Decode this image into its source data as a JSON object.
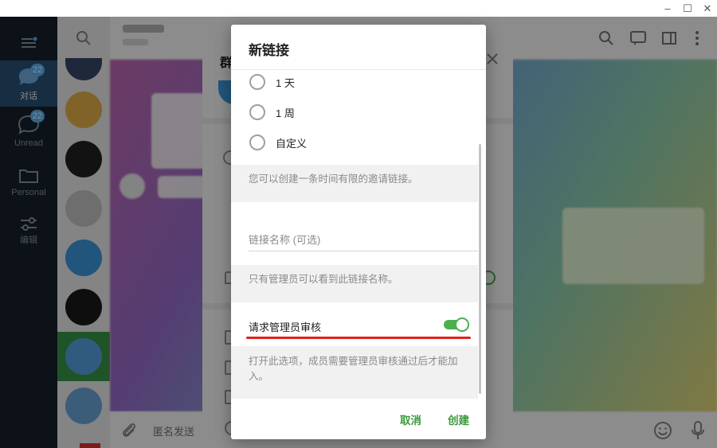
{
  "window": {
    "minimize_glyph": "–",
    "maximize_glyph": "☐",
    "close_glyph": "✕"
  },
  "rail": {
    "items": [
      {
        "label": "对话",
        "badge": "22",
        "icon": "chat-bubble-icon"
      },
      {
        "label": "Unread",
        "badge": "22",
        "icon": "chat-outline-icon"
      },
      {
        "label": "Personal",
        "icon": "folder-icon"
      },
      {
        "label": "编辑",
        "icon": "sliders-icon"
      }
    ]
  },
  "background_dialog": {
    "title_fragment": "群"
  },
  "conversation": {
    "input_placeholder": "匿名发送"
  },
  "modal": {
    "title": "新链接",
    "options": [
      {
        "label": "1 天",
        "selected": false
      },
      {
        "label": "1 周",
        "selected": false
      },
      {
        "label": "自定义",
        "selected": false
      }
    ],
    "time_limit_hint": "您可以创建一条时间有限的邀请链接。",
    "name_placeholder": "链接名称 (可选)",
    "name_value": "",
    "name_hint": "只有管理员可以看到此链接名称。",
    "approval_label": "请求管理员审核",
    "approval_enabled": true,
    "approval_hint": "打开此选项，成员需要管理员审核通过后才能加入。",
    "cancel_label": "取消",
    "create_label": "创建"
  },
  "colors": {
    "accent_green": "#4caf50",
    "button_green": "#3a9a3a",
    "highlight_red": "#e0201c",
    "rail_bg": "#17212b",
    "rail_active": "#2b5278",
    "badge_blue": "#5eb5f7"
  }
}
